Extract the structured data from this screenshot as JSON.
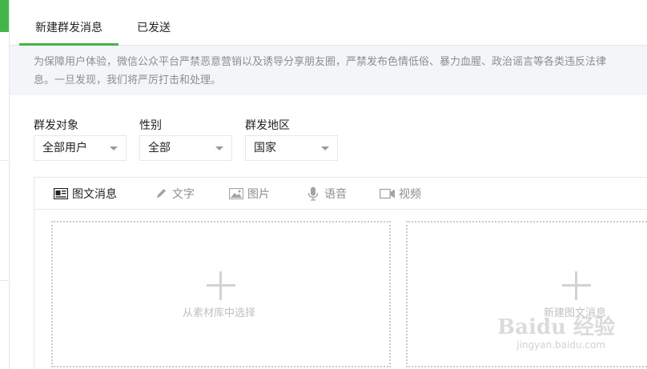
{
  "tabs": [
    {
      "label": "新建群发消息",
      "active": true
    },
    {
      "label": "已发送",
      "active": false
    }
  ],
  "notice": {
    "line1": "为保障用户体验，微信公众平台严禁恶意营销以及诱导分享朋友圈，严禁发布色情低俗、暴力血腥、政治谣言等各类违反法律",
    "line2": "息。一旦发现，我们将严厉打击和处理。"
  },
  "filters": [
    {
      "label": "群发对象",
      "value": "全部用户"
    },
    {
      "label": "性别",
      "value": "全部"
    },
    {
      "label": "群发地区",
      "value": "国家"
    }
  ],
  "editor_tabs": [
    {
      "label": "图文消息",
      "icon": "article-icon",
      "active": true
    },
    {
      "label": "文字",
      "icon": "pencil-icon",
      "active": false
    },
    {
      "label": "图片",
      "icon": "image-icon",
      "active": false
    },
    {
      "label": "语音",
      "icon": "microphone-icon",
      "active": false
    },
    {
      "label": "视频",
      "icon": "video-camera-icon",
      "active": false
    }
  ],
  "dropzones": [
    {
      "label": "从素材库中选择"
    },
    {
      "label": "新建图文消息"
    }
  ],
  "watermark": {
    "brand": "Baidu 经验",
    "url": "jingyan.baidu.com"
  },
  "colors": {
    "accent": "#44b549",
    "notice_bg": "#f4f5f9",
    "border": "#e7e7eb"
  }
}
